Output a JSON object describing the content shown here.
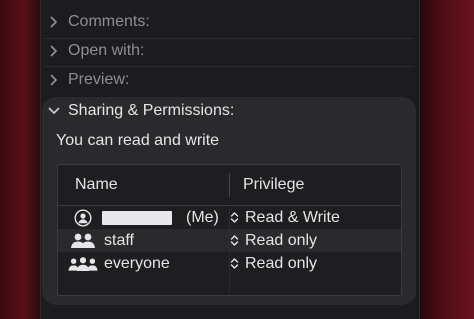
{
  "info_panel": {
    "collapsed_sections": [
      {
        "label": "Comments:"
      },
      {
        "label": "Open with:"
      },
      {
        "label": "Preview:"
      }
    ],
    "sharing": {
      "label": "Sharing & Permissions:",
      "summary": "You can read and write",
      "table": {
        "headers": {
          "name": "Name",
          "privilege": "Privilege"
        },
        "rows": [
          {
            "icon": "person-circle-icon",
            "name": "",
            "suffix": "(Me)",
            "privilege": "Read & Write"
          },
          {
            "icon": "two-people-icon",
            "name": "staff",
            "suffix": "",
            "privilege": "Read only"
          },
          {
            "icon": "three-people-icon",
            "name": "everyone",
            "suffix": "",
            "privilege": "Read only"
          }
        ]
      }
    }
  }
}
